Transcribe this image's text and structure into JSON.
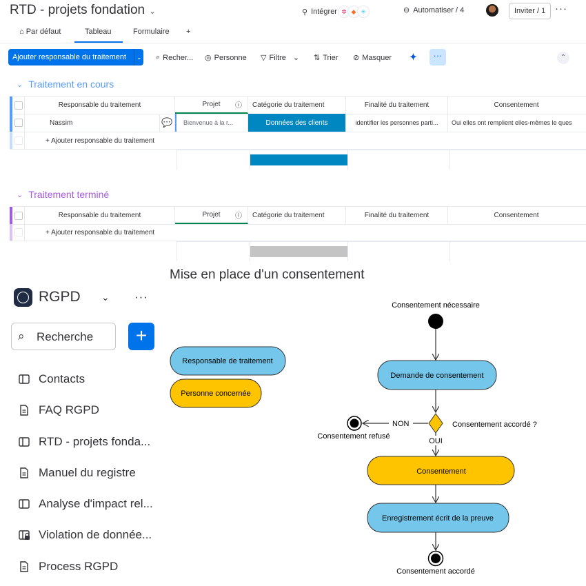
{
  "header": {
    "title": "RTD - projets fondation",
    "integrate_label": "Intégrer",
    "automate_label": "Automatiser / 4",
    "invite_label": "Inviter / 1",
    "more_label": "···"
  },
  "views": {
    "tabs": [
      "Par défaut",
      "Tableau",
      "Formulaire",
      "+"
    ],
    "active": "Tableau"
  },
  "toolbar": {
    "new_item_label": "Ajouter responsable du traitement",
    "search_label": "Recher...",
    "person_label": "Personne",
    "filter_label": "Filtre",
    "sort_label": "Trier",
    "hide_label": "Masquer",
    "more_label": "···"
  },
  "columns": {
    "name": "Responsable du traitement",
    "project": "Projet",
    "category": "Catégorie du traitement",
    "purpose": "Finalité du traitement",
    "consent": "Consentement"
  },
  "groups": [
    {
      "title": "Traitement en cours",
      "color": "#579bfc",
      "rows": [
        {
          "name": "Nassim",
          "project": "Bienvenue à la r...",
          "category": "Données des clients",
          "purpose": "identifier les personnes parti...",
          "consent": "Oui elles ont remplient elles-mêmes le ques"
        }
      ],
      "add_label": "+ Ajouter responsable du traitement"
    },
    {
      "title": "Traitement terminé",
      "color": "#a25ddc",
      "rows": [],
      "add_label": "+ Ajouter responsable du traitement"
    }
  ],
  "colors": {
    "primary": "#0073ea",
    "category_fill": "#0086c0",
    "diagram_blue": "#74c6ea",
    "diagram_yellow": "#ffc400"
  },
  "sidebar": {
    "workspace": "RGPD",
    "search_placeholder": "Recherche",
    "items": [
      {
        "label": "Contacts",
        "icon": "board-icon"
      },
      {
        "label": "FAQ RGPD",
        "icon": "doc-icon"
      },
      {
        "label": "RTD - projets fonda...",
        "icon": "board-icon"
      },
      {
        "label": "Manuel du registre",
        "icon": "doc-icon"
      },
      {
        "label": "Analyse d'impact rel...",
        "icon": "board-icon"
      },
      {
        "label": "Violation de donnée...",
        "icon": "locked-board-icon"
      },
      {
        "label": "Process RGPD",
        "icon": "doc-icon"
      }
    ]
  },
  "diagram": {
    "title": "Mise en place d'un consentement",
    "legend": [
      "Responsable de traitement",
      "Personne concernée"
    ],
    "start_label": "Consentement nécessaire",
    "request": "Demande de consentement",
    "decision_label": "Consentement accordé ?",
    "no_label": "NON",
    "yes_label": "OUI",
    "refused_label": "Consentement refusé",
    "consent": "Consentement",
    "record": "Enregistrement écrit de la preuve",
    "end_label": "Consentement accordé"
  }
}
